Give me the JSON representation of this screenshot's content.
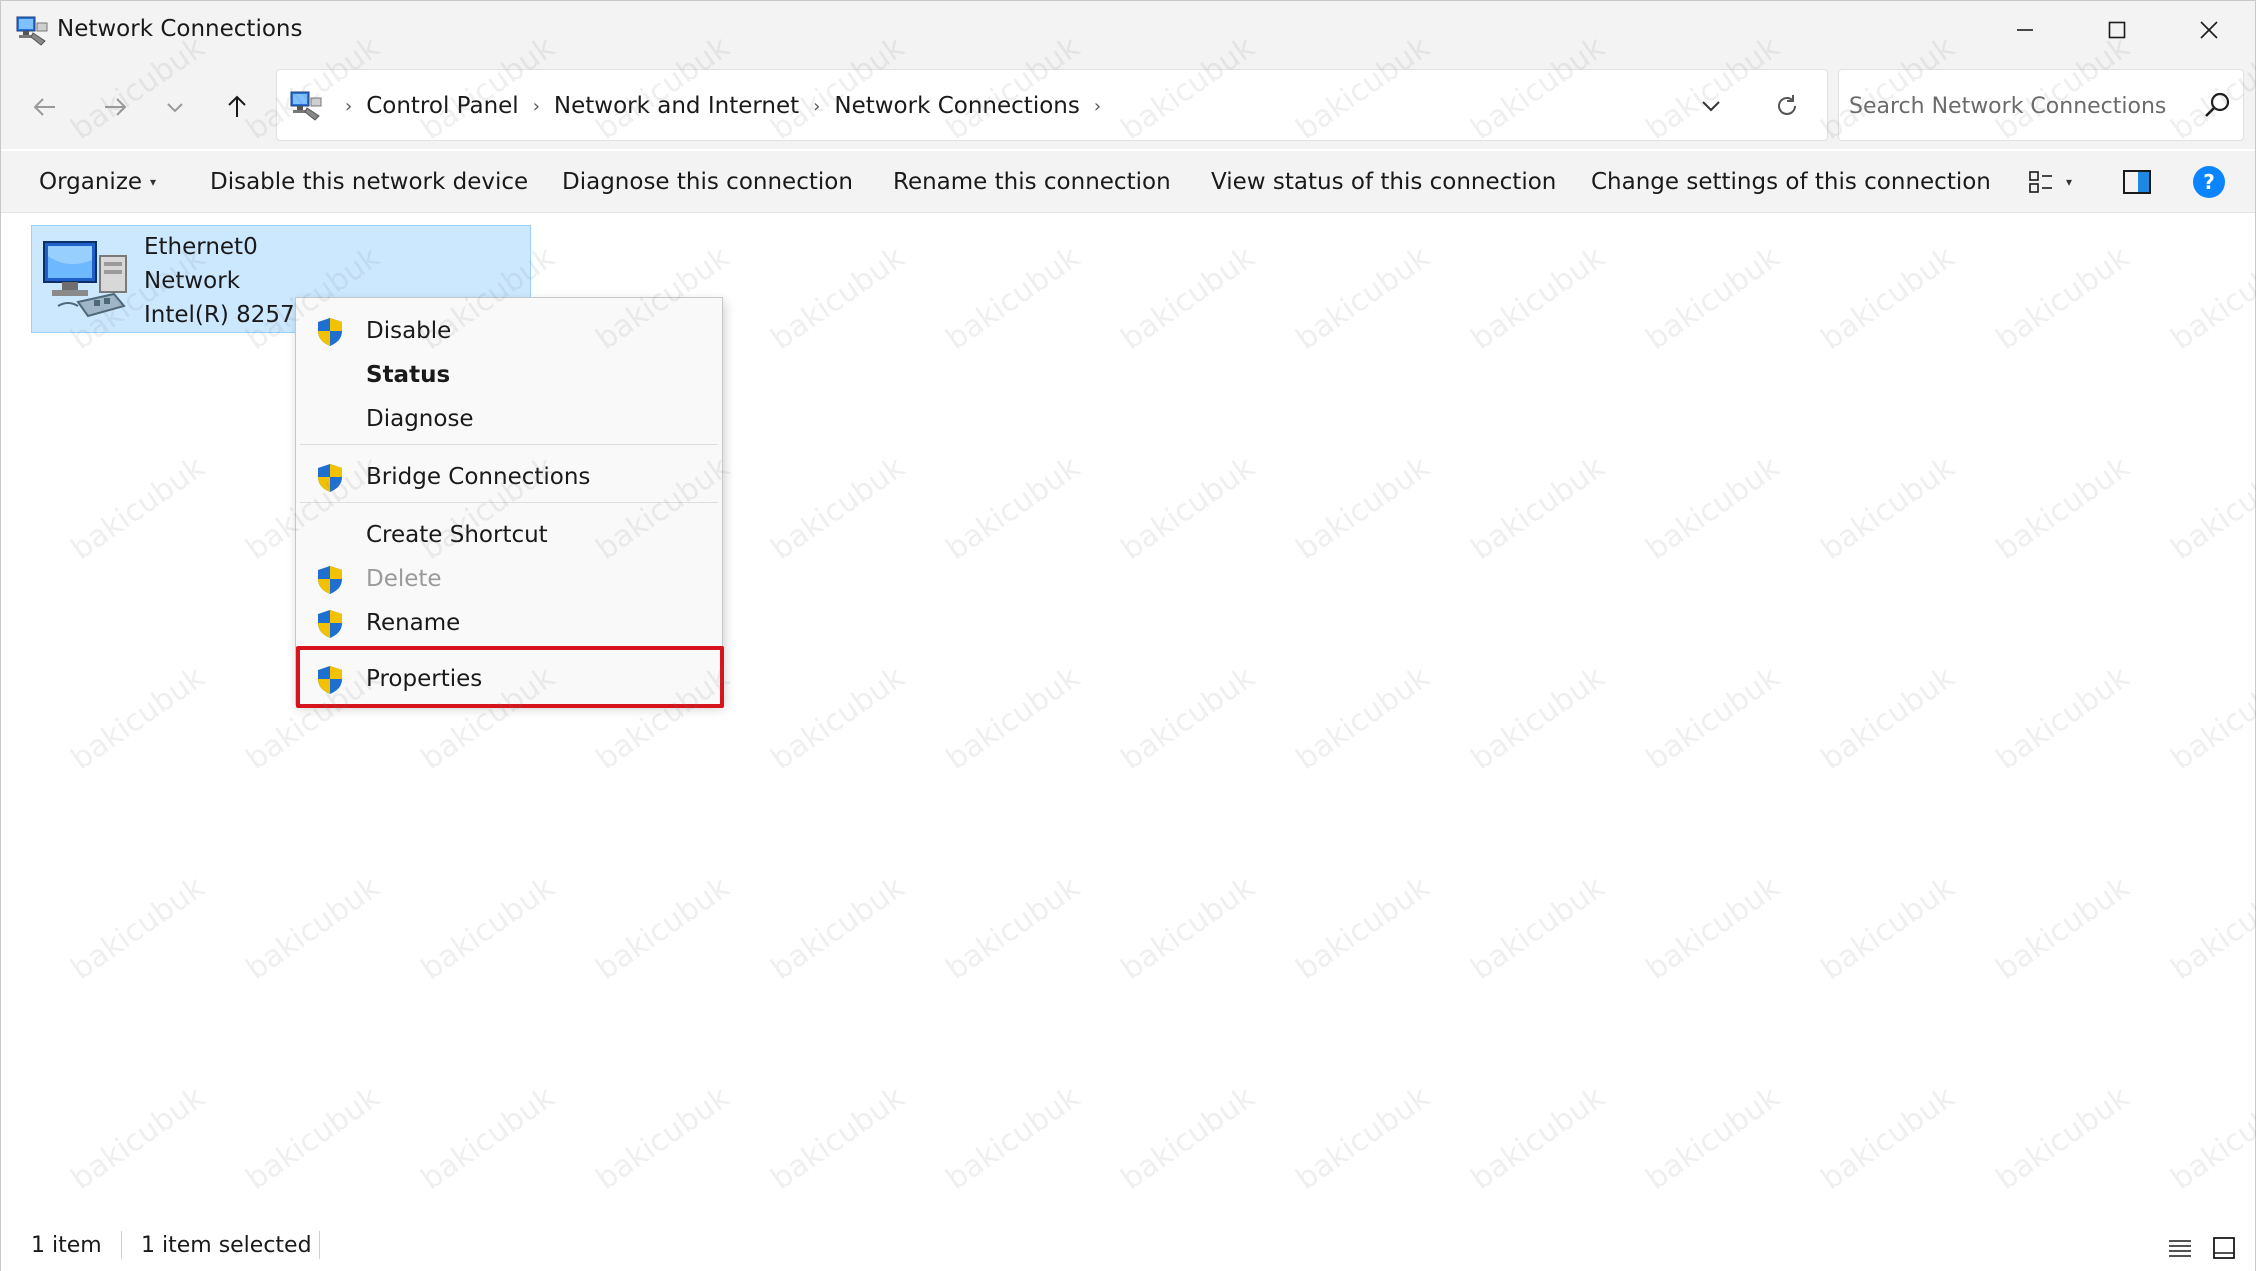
{
  "window": {
    "title": "Network Connections"
  },
  "address": {
    "breadcrumbs": [
      "Control Panel",
      "Network and Internet",
      "Network Connections"
    ]
  },
  "search": {
    "placeholder": "Search Network Connections"
  },
  "commandbar": {
    "organize": "Organize",
    "disable_device": "Disable this network device",
    "diagnose": "Diagnose this connection",
    "rename": "Rename this connection",
    "view_status": "View status of this connection",
    "change_settings": "Change settings of this connection"
  },
  "item": {
    "name": "Ethernet0",
    "status": "Network",
    "device": "Intel(R) 82574L"
  },
  "context_menu": {
    "disable": "Disable",
    "status": "Status",
    "diagnose": "Diagnose",
    "bridge": "Bridge Connections",
    "create_shortcut": "Create Shortcut",
    "delete": "Delete",
    "rename": "Rename",
    "properties": "Properties"
  },
  "statusbar": {
    "count": "1 item",
    "selected": "1 item selected"
  },
  "watermark": "bakicubuk",
  "colors": {
    "selection_bg": "#cce8ff",
    "selection_border": "#99d1ff",
    "highlight_red": "#d6141c",
    "help_blue": "#0a84ff"
  }
}
